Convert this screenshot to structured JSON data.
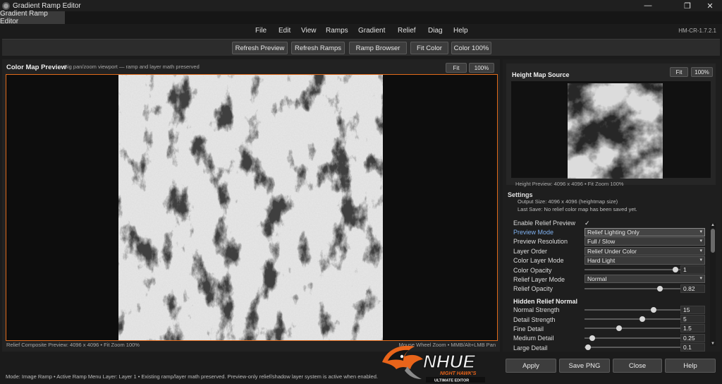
{
  "window": {
    "title": "Gradient Ramp Editor",
    "controls": {
      "minimize": "—",
      "restore": "❐",
      "close": "✕"
    }
  },
  "tabs": [
    {
      "label": "Gradient Ramp Editor"
    }
  ],
  "menu": {
    "items": [
      "File",
      "Edit",
      "View",
      "Ramps",
      "Gradient",
      "Relief",
      "Diag",
      "Help"
    ],
    "version": "HM-CR-1.7.2.1"
  },
  "toolbar": {
    "buttons": [
      "Refresh Preview",
      "Refresh Ramps",
      "Ramp Browser",
      "Fit Color",
      "Color 100%"
    ]
  },
  "color_map": {
    "title": "Color Map Preview",
    "subtitle": "Big pan/zoom viewport — ramp and layer math preserved",
    "fit_label": "Fit",
    "zoom_label": "100%",
    "footer": "Relief Composite Preview: 4096 x 4096  •  Fit Zoom 100%",
    "footer_right": "Mouse Wheel Zoom  •  MMB/Alt+LMB Pan"
  },
  "height_map": {
    "title": "Height Map Source",
    "fit_label": "Fit",
    "zoom_label": "100%",
    "footer": "Height Preview: 4096 x 4096  •  Fit Zoom 100%"
  },
  "settings": {
    "title": "Settings",
    "output_size": "Output Size: 4096 x 4096 (heightmap size)",
    "last_save": "Last Save: No relief color map has been saved yet.",
    "enable_relief": {
      "label": "Enable Relief Preview",
      "checked": "✓"
    },
    "preview_mode": {
      "label": "Preview Mode",
      "value": "Relief Lighting Only"
    },
    "preview_resolution": {
      "label": "Preview Resolution",
      "value": "Full / Slow"
    },
    "layer_order": {
      "label": "Layer Order",
      "value": "Relief Under Color"
    },
    "color_layer_mode": {
      "label": "Color Layer Mode",
      "value": "Hard Light"
    },
    "color_opacity": {
      "label": "Color Opacity",
      "value": "1",
      "fraction": 0.95
    },
    "relief_layer_mode": {
      "label": "Relief Layer Mode",
      "value": "Normal"
    },
    "relief_opacity": {
      "label": "Relief Opacity",
      "value": "0.82",
      "fraction": 0.79
    },
    "hidden_relief_title": "Hidden Relief Normal",
    "normal_strength": {
      "label": "Normal Strength",
      "value": "15",
      "fraction": 0.72
    },
    "detail_strength": {
      "label": "Detail Strength",
      "value": "5",
      "fraction": 0.6
    },
    "fine_detail": {
      "label": "Fine Detail",
      "value": "1.5",
      "fraction": 0.36
    },
    "medium_detail": {
      "label": "Medium Detail",
      "value": "0.25",
      "fraction": 0.08
    },
    "large_detail": {
      "label": "Large Detail",
      "value": "0.1",
      "fraction": 0.04
    }
  },
  "status": {
    "text": "Mode: Image Ramp  •  Active Ramp Menu Layer: Layer 1  •  Existing ramp/layer math preserved. Preview-only relief/shadow layer system is active when enabled."
  },
  "logo": {
    "main_text": "NHUE",
    "sub_text": "NIGHT HAWK'S",
    "tagline": "ULTIMATE EDITOR",
    "colors": {
      "accent": "#e8641a",
      "dark": "#101010",
      "light": "#f2f2f2"
    }
  },
  "actions": {
    "apply": "Apply",
    "save": "Save PNG",
    "close": "Close",
    "help": "Help"
  },
  "icons": {
    "app": "app-icon",
    "caret": "▾",
    "check": "checkmark-icon"
  },
  "colors": {
    "accent_border": "#e06a1a",
    "link_blue": "#7fb0ee",
    "panel": "#222222"
  }
}
